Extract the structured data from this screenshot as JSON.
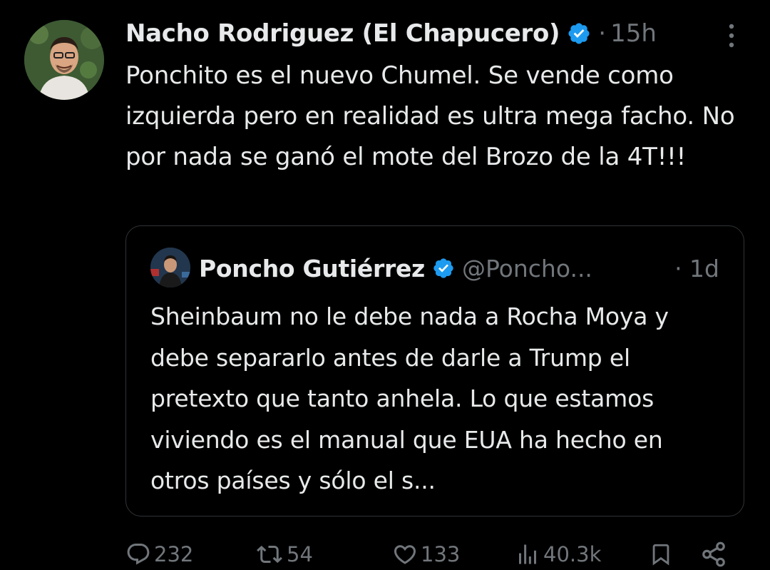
{
  "tweet": {
    "author_name": "Nacho Rodriguez (El Chapucero)",
    "separator": "·",
    "time": "15h",
    "text": "Ponchito es el nuevo Chumel. Se vende como izquierda pero en realidad es ultra mega facho. No por nada se ganó el mote del Brozo de la 4T!!!"
  },
  "quoted_tweet": {
    "author_name": "Poncho Gutiérrez",
    "handle": "@Poncho...",
    "time": "· 1d",
    "text": "Sheinbaum no le debe nada a Rocha Moya y debe separarlo antes de darle a Trump el pretexto que tanto anhela. Lo que estamos viviendo es el manual que EUA ha hecho en otros países y sólo el s..."
  },
  "actions": {
    "replies": "232",
    "retweets": "54",
    "likes": "133",
    "views": "40.3k"
  },
  "icons": {
    "verified": "verified-badge-icon",
    "more": "more-options-icon",
    "reply": "reply-icon",
    "retweet": "retweet-icon",
    "like": "like-icon",
    "views": "views-icon",
    "bookmark": "bookmark-icon",
    "share": "share-icon"
  },
  "colors": {
    "background": "#000000",
    "text": "#e7e9ea",
    "secondary": "#71767b",
    "verified": "#1d9bf0",
    "border": "#2f3336"
  }
}
